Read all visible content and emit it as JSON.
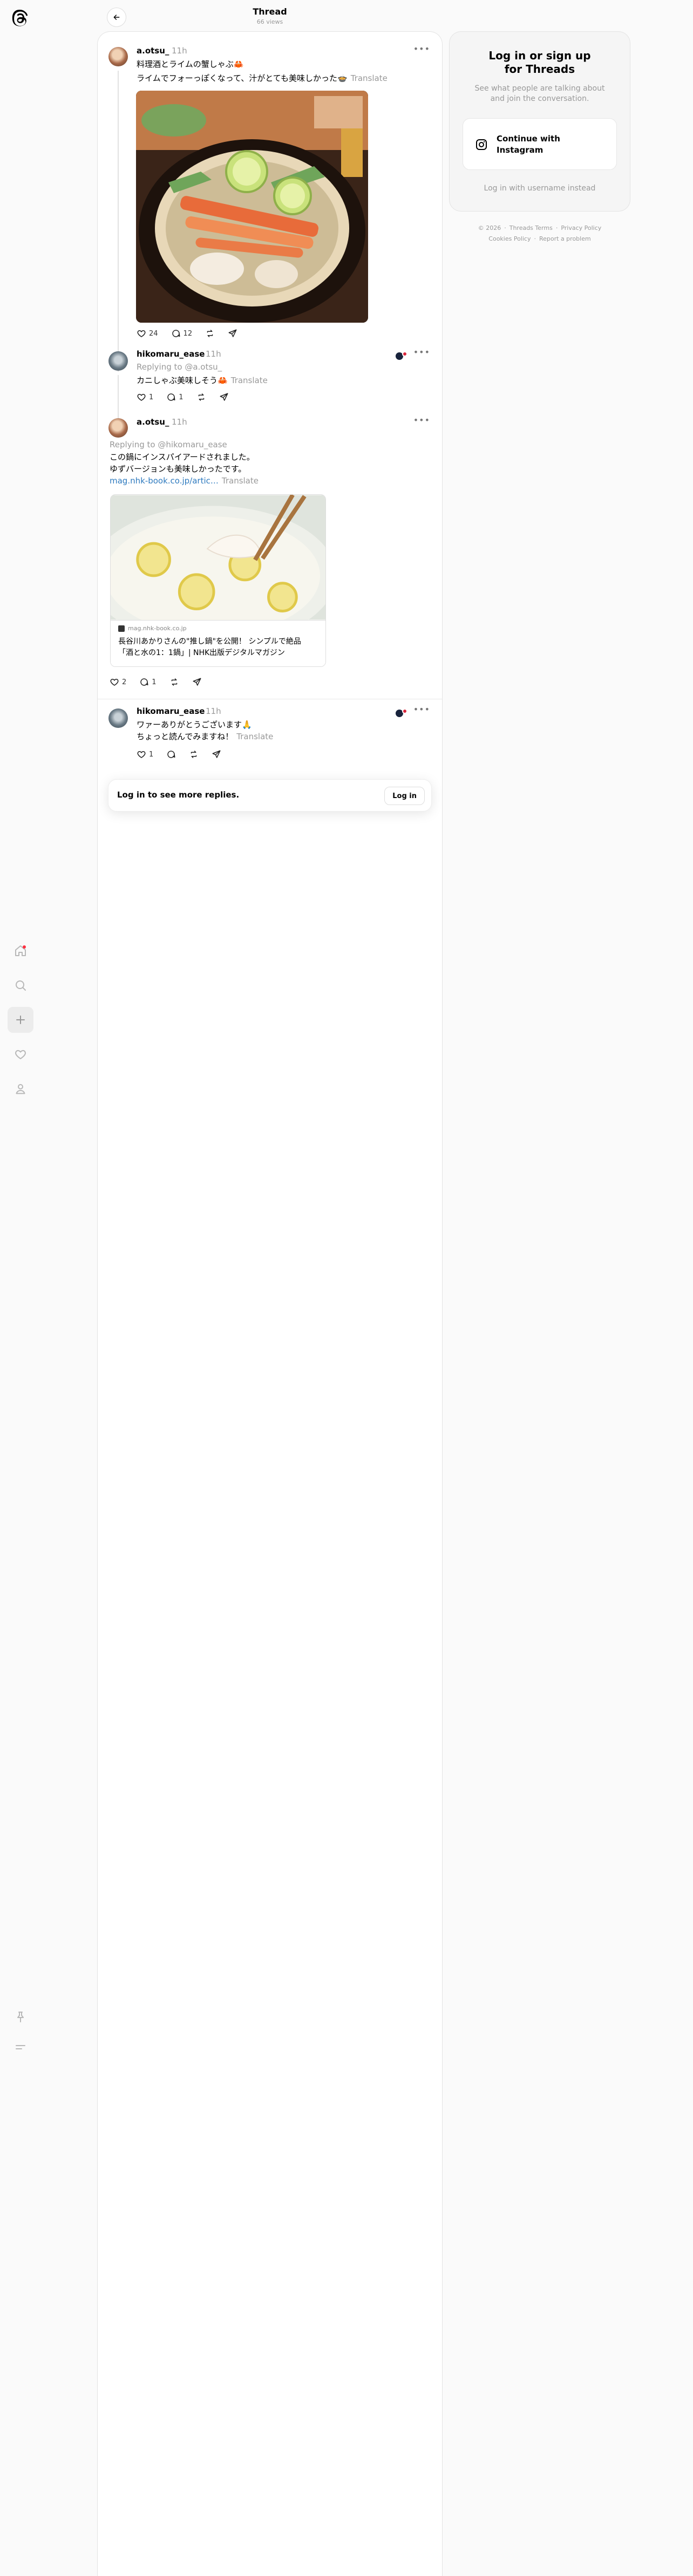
{
  "header": {
    "title": "Thread",
    "views": "66 views"
  },
  "posts": [
    {
      "username": "a.otsu_",
      "time": "11h",
      "lines": [
        "料理酒とライムの蟹しゃぶ🦀",
        "ライムでフォーっぽくなって、汁がとても美味しかった🍲"
      ],
      "translate": "Translate",
      "likes": "24",
      "replies": "12"
    },
    {
      "username": "hikomaru_ease",
      "time": "11h",
      "replying_to": "Replying to @a.otsu_",
      "lines": [
        "カニしゃぶ美味しそう🦀"
      ],
      "translate": "Translate",
      "likes": "1",
      "replies": "1"
    },
    {
      "username": "a.otsu_",
      "time": "11h",
      "replying_to": "Replying to @hikomaru_ease",
      "lines": [
        "この鍋にインスパイアードされました。",
        "ゆずバージョンも美味しかったです。"
      ],
      "link_text": "mag.nhk-book.co.jp/artic…",
      "translate": "Translate",
      "card_domain": "mag.nhk-book.co.jp",
      "card_title_1": "長谷川あかりさんの\"推し鍋\"を公開！ シンプルで絶品",
      "card_title_2": "「酒と水の1：1鍋」| NHK出版デジタルマガジン",
      "likes": "2",
      "replies": "1"
    },
    {
      "username": "hikomaru_ease",
      "time": "11h",
      "lines": [
        "ワァーありがとうございます🙏",
        "ちょっと読んでみますね！"
      ],
      "translate": "Translate",
      "likes": "1",
      "replies": ""
    }
  ],
  "login_prompt": {
    "text": "Log in to see more replies.",
    "button": "Log in"
  },
  "side": {
    "title_1": "Log in or sign up",
    "title_2": "for Threads",
    "sub_1": "See what people are talking about",
    "sub_2": "and join the conversation.",
    "ig_1": "Continue with",
    "ig_2": "Instagram",
    "alt": "Log in with username instead"
  },
  "footer": {
    "year": "© 2026",
    "terms": "Threads Terms",
    "privacy": "Privacy Policy",
    "cookies": "Cookies Policy",
    "report": "Report a problem"
  },
  "icons": [
    "threads-logo-icon",
    "home-icon",
    "search-icon",
    "create-icon",
    "activity-icon",
    "profile-icon",
    "pin-icon",
    "menu-icon",
    "back-arrow-icon",
    "more-icon",
    "heart-icon",
    "comment-icon",
    "repost-icon",
    "share-icon",
    "instagram-icon"
  ],
  "colors": {
    "accent_link": "#2f7bbf",
    "notify_red": "#ff3040"
  }
}
